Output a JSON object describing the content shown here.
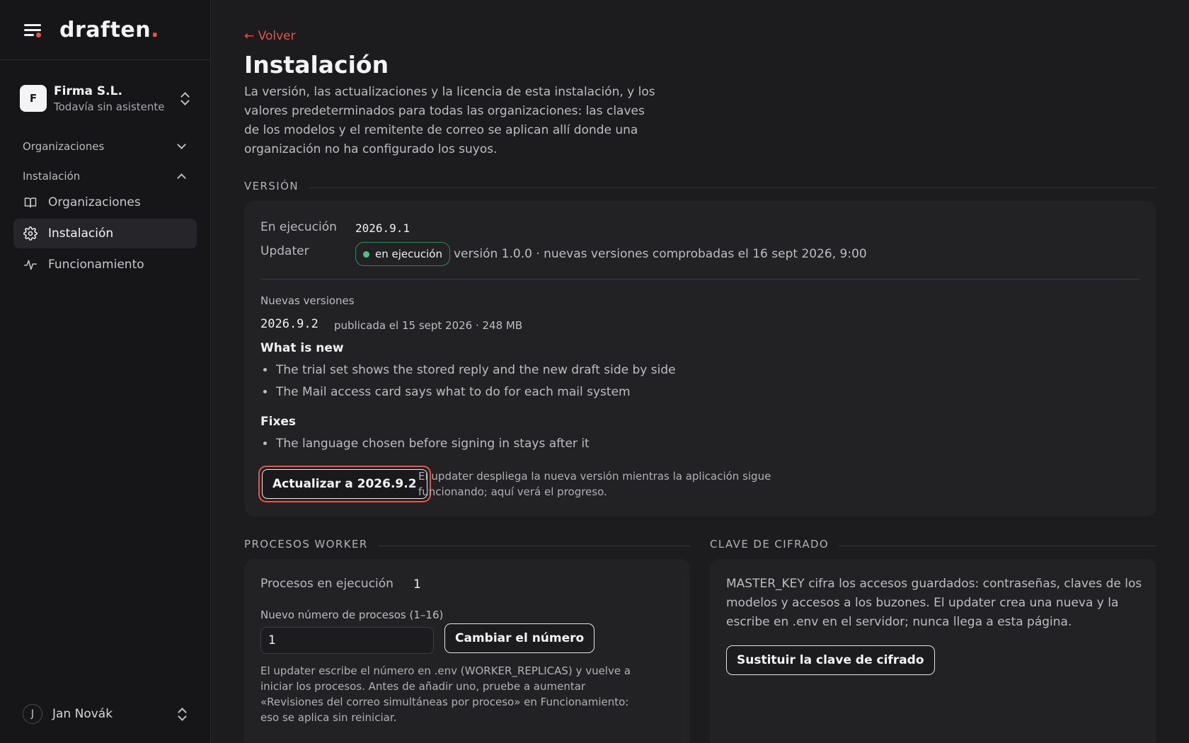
{
  "brand": {
    "name": "draften",
    "dot": "."
  },
  "org": {
    "avatar": "F",
    "name": "Firma S.L.",
    "subtitle": "Todavía sin asistente"
  },
  "sidebar": {
    "groups": [
      {
        "label": "Organizaciones",
        "expanded": false
      },
      {
        "label": "Instalación",
        "expanded": true
      }
    ],
    "items": [
      {
        "label": "Organizaciones",
        "icon": "book-icon",
        "active": false
      },
      {
        "label": "Instalación",
        "icon": "gear-icon",
        "active": true
      },
      {
        "label": "Funcionamiento",
        "icon": "activity-icon",
        "active": false
      }
    ]
  },
  "user": {
    "avatar": "J",
    "name": "Jan Novák"
  },
  "page": {
    "back": "← Volver",
    "title": "Instalación",
    "description": "La versión, las actualizaciones y la licencia de esta instalación, y los valores predeterminados para todas las organizaciones: las claves de los modelos y el remitente de correo se aplican allí donde una organización no ha configurado los suyos."
  },
  "version": {
    "section": "VERSIÓN",
    "running_label": "En ejecución",
    "running_value": "2026.9.1",
    "updater_label": "Updater",
    "updater_badge": "en ejecución",
    "updater_meta": "versión 1.0.0 · nuevas versiones comprobadas el 16 sept 2026, 9:00",
    "new_versions_label": "Nuevas versiones",
    "new_version": "2026.9.2",
    "new_version_meta": "publicada el 15 sept 2026 · 248 MB",
    "whats_new_title": "What is new",
    "whats_new": [
      "The trial set shows the stored reply and the new draft side by side",
      "The Mail access card says what to do for each mail system"
    ],
    "fixes_title": "Fixes",
    "fixes": [
      "The language chosen before signing in stays after it"
    ],
    "update_button": "Actualizar a 2026.9.2",
    "update_note_1": "El updater despliega la nueva versión mientras la aplicación sigue",
    "update_note_2": "funcionando; aquí verá el progreso."
  },
  "workers": {
    "section": "PROCESOS WORKER",
    "running_label": "Procesos en ejecución",
    "running_value": "1",
    "new_label": "Nuevo número de procesos (1–16)",
    "input_value": "1",
    "change_button": "Cambiar el número",
    "note_1": "El updater escribe el número en .env (WORKER_REPLICAS) y vuelve a",
    "note_2": "iniciar los procesos. Antes de añadir uno, pruebe a aumentar",
    "note_3": "«Revisiones del correo simultáneas por proceso» en Funcionamiento:",
    "note_4": "eso se aplica sin reiniciar."
  },
  "encryption": {
    "section": "CLAVE DE CIFRADO",
    "text_1": "MASTER_KEY cifra los accesos guardados: contraseñas, claves de los",
    "text_2": "modelos y accesos a los buzones. El updater crea una nueva y la",
    "text_3": "escribe en .env en el servidor; nunca llega a esta página.",
    "button": "Sustituir la clave de cifrado"
  },
  "colors": {
    "accent": "#e8553d",
    "success": "#44c77e",
    "background": "#1c1c1e",
    "card": "#222225"
  }
}
